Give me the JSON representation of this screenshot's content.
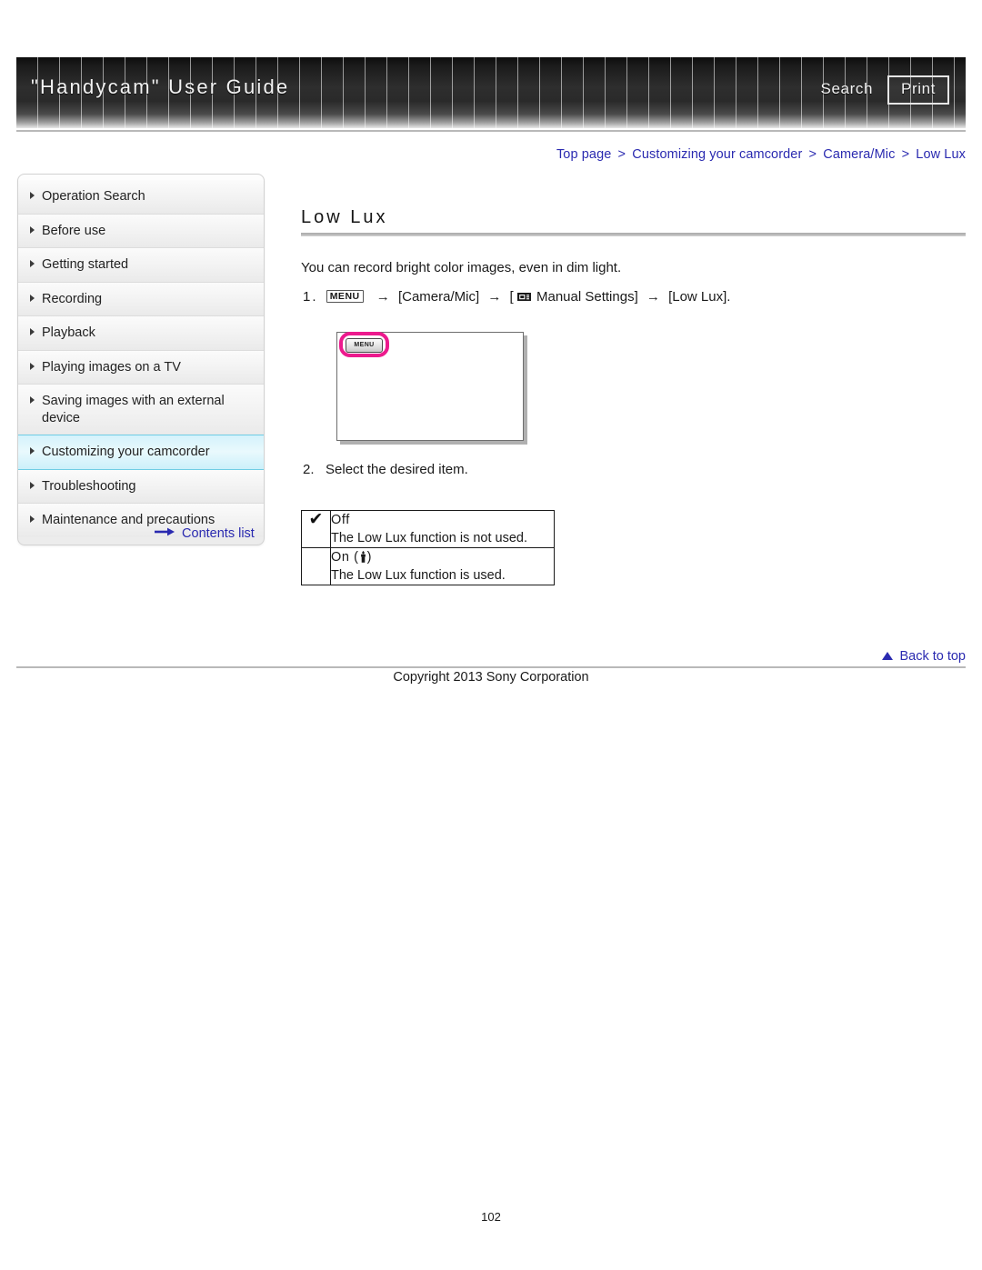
{
  "header": {
    "title": "\"Handycam\" User Guide",
    "search_label": "Search",
    "print_label": "Print"
  },
  "breadcrumb": {
    "separator": ">",
    "items": [
      {
        "label": "Top page"
      },
      {
        "label": "Customizing your camcorder"
      },
      {
        "label": "Camera/Mic"
      },
      {
        "label": "Low Lux"
      }
    ]
  },
  "sidebar": {
    "items": [
      {
        "label": "Operation Search",
        "active": false
      },
      {
        "label": "Before use",
        "active": false
      },
      {
        "label": "Getting started",
        "active": false
      },
      {
        "label": "Recording",
        "active": false
      },
      {
        "label": "Playback",
        "active": false
      },
      {
        "label": "Playing images on a TV",
        "active": false
      },
      {
        "label": "Saving images with an external device",
        "active": false
      },
      {
        "label": "Customizing your camcorder",
        "active": true
      },
      {
        "label": "Troubleshooting",
        "active": false
      },
      {
        "label": "Maintenance and precautions",
        "active": false
      }
    ],
    "contents_list_label": "Contents list"
  },
  "main": {
    "page_title": "Low Lux",
    "intro": "You can record bright color images, even in dim light.",
    "step1": {
      "number": "1.",
      "menu_chip": "MENU",
      "arrow": "→",
      "part_camera_mic": "[Camera/Mic]",
      "bracket_open": "[",
      "part_manual_settings": "Manual Settings]",
      "part_low_lux": "[Low Lux]."
    },
    "figure": {
      "menu_button_label": "MENU"
    },
    "step2": {
      "number": "2.",
      "text": "Select the desired item."
    },
    "options_table": {
      "rows": [
        {
          "mark": "✔",
          "name": "Off",
          "description": "The Low Lux function is not used."
        },
        {
          "mark": "",
          "name": "On (",
          "name_suffix": ")",
          "description": "The Low Lux function is used."
        }
      ]
    }
  },
  "footer": {
    "back_to_top_label": "Back to top",
    "copyright": "Copyright 2013 Sony Corporation",
    "page_number": "102"
  },
  "colors": {
    "link": "#2a2ab0",
    "highlight_pink": "#ec1a8d",
    "nav_active_border": "#6fcde4",
    "rule": "#b9b9b9"
  }
}
